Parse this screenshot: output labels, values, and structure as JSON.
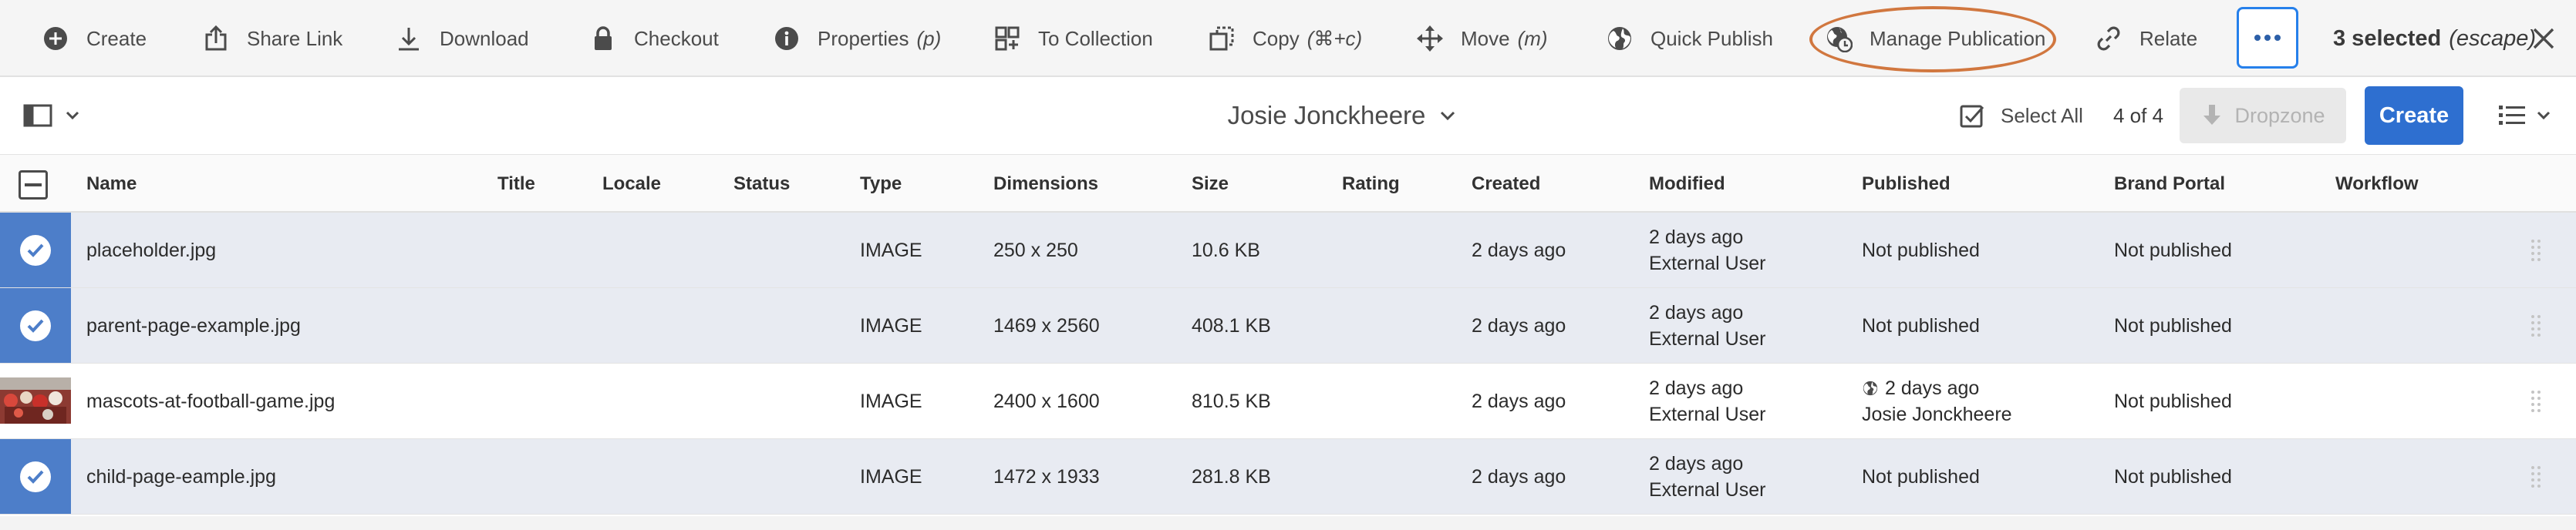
{
  "toolbar": {
    "actions": [
      {
        "label": "Create",
        "icon": "add-circle-icon"
      },
      {
        "label": "Share Link",
        "icon": "share-icon"
      },
      {
        "label": "Download",
        "icon": "download-icon"
      },
      {
        "label": "Checkout",
        "icon": "lock-icon"
      },
      {
        "label": "Properties",
        "shortcut": "(p)",
        "icon": "info-icon"
      },
      {
        "label": "To Collection",
        "icon": "collection-add-icon"
      },
      {
        "label": "Copy",
        "shortcut": "(⌘+c)",
        "icon": "copy-icon"
      },
      {
        "label": "Move",
        "shortcut": "(m)",
        "icon": "move-icon"
      },
      {
        "label": "Quick Publish",
        "icon": "globe-icon"
      },
      {
        "label": "Manage Publication",
        "icon": "globe-clock-icon"
      },
      {
        "label": "Relate",
        "icon": "link-icon"
      }
    ],
    "more_icon": "more-icon",
    "selected_count": "3 selected",
    "escape_hint": "(escape)",
    "close_icon": "close-icon",
    "highlight_color": "#d1773f",
    "accent_color": "#2680eb"
  },
  "subbar": {
    "rail_icon": "rail-toggle-icon",
    "folder_title": "Josie Jonckheere",
    "select_all_label": "Select All",
    "count_label": "4 of 4",
    "dropzone_label": "Dropzone",
    "create_label": "Create",
    "create_color": "#2e6fd0",
    "view_icon": "list-view-icon"
  },
  "table": {
    "columns": [
      "Name",
      "Title",
      "Locale",
      "Status",
      "Type",
      "Dimensions",
      "Size",
      "Rating",
      "Created",
      "Modified",
      "Published",
      "Brand Portal",
      "Workflow"
    ],
    "rows": [
      {
        "selected": true,
        "name": "placeholder.jpg",
        "title": "",
        "locale": "",
        "status": "",
        "type": "IMAGE",
        "dimensions": "250 x 250",
        "size": "10.6 KB",
        "rating": "",
        "created": "2 days ago",
        "modified_time": "2 days ago",
        "modified_by": "External User",
        "published_line1": "Not published",
        "published_line2": "",
        "brand_portal": "Not published",
        "workflow": ""
      },
      {
        "selected": true,
        "name": "parent-page-example.jpg",
        "title": "",
        "locale": "",
        "status": "",
        "type": "IMAGE",
        "dimensions": "1469 x 2560",
        "size": "408.1 KB",
        "rating": "",
        "created": "2 days ago",
        "modified_time": "2 days ago",
        "modified_by": "External User",
        "published_line1": "Not published",
        "published_line2": "",
        "brand_portal": "Not published",
        "workflow": ""
      },
      {
        "selected": false,
        "name": "mascots-at-football-game.jpg",
        "title": "",
        "locale": "",
        "status": "",
        "type": "IMAGE",
        "dimensions": "2400 x 1600",
        "size": "810.5 KB",
        "rating": "",
        "created": "2 days ago",
        "modified_time": "2 days ago",
        "modified_by": "External User",
        "published_line1": "2 days ago",
        "published_line2": "Josie Jonckheere",
        "brand_portal": "Not published",
        "workflow": ""
      },
      {
        "selected": true,
        "name": "child-page-eample.jpg",
        "title": "",
        "locale": "",
        "status": "",
        "type": "IMAGE",
        "dimensions": "1472 x 1933",
        "size": "281.8 KB",
        "rating": "",
        "created": "2 days ago",
        "modified_time": "2 days ago",
        "modified_by": "External User",
        "published_line1": "Not published",
        "published_line2": "",
        "brand_portal": "Not published",
        "workflow": ""
      }
    ]
  }
}
